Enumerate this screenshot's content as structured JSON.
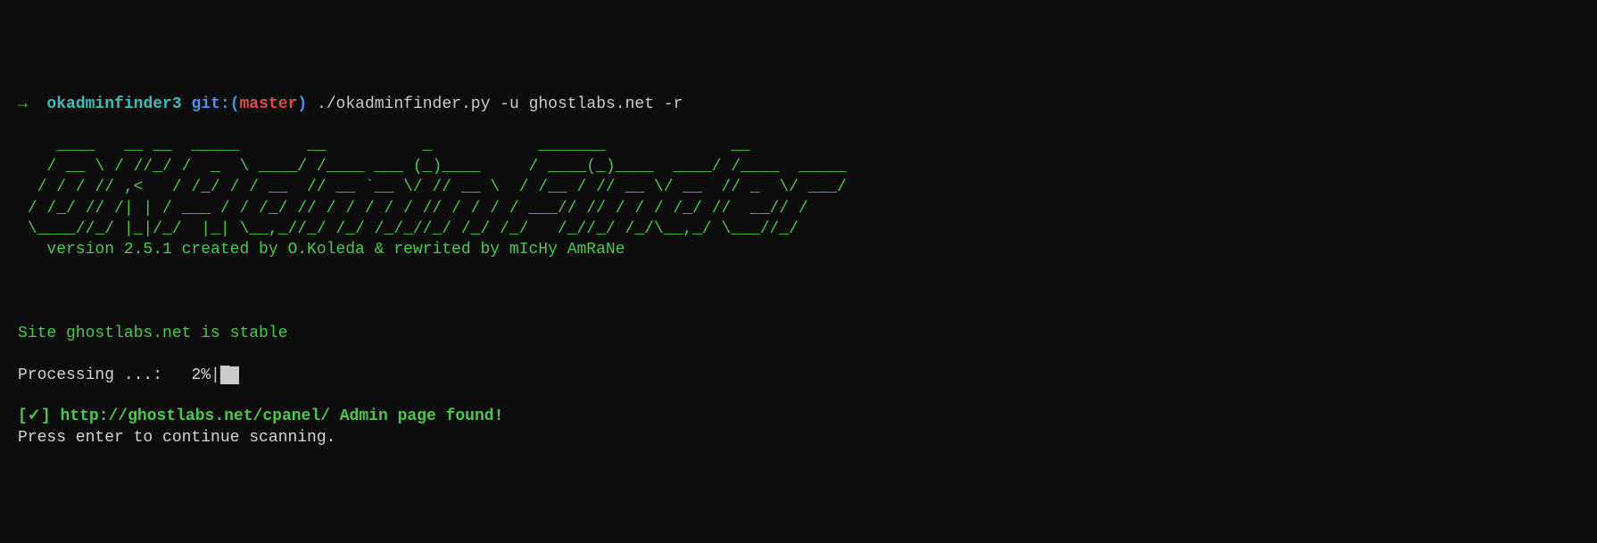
{
  "prompt": {
    "arrow": "→",
    "dir": "okadminfinder3",
    "git_label": "git:",
    "paren_open": "(",
    "branch": "master",
    "paren_close": ")",
    "command": "./okadminfinder.py -u ghostlabs.net -r"
  },
  "ascii_art": "    ____   __ __  _____       __          _           _______             __             \n   / __ \\ / //_/ /  _  \\ ____/ /____ ___ (_)____     / ____(_)____  ____/ /____  _____  \n  / / / // ,<   / /_/ / / __  // __ `__ \\/ // __ \\  / /__ / // __ \\/ __  // _  \\/ ___/  \n / /_/ // /| | / ___ / / /_/ // / / / / / // / / / / ___// // / / / /_/ //  __// /      \n \\____//_/ |_|/_/  |_| \\__,_//_/ /_/ /_/_//_/ /_/ /_/   /_//_/ /_/\\__,_/ \\___//_/       ",
  "version_line": "   version 2.5.1 created by O.Koleda & rewrited by mIcHy AmRaNe",
  "status_line": "Site ghostlabs.net is stable",
  "processing": {
    "label": "Processing ...:   ",
    "percent": "2%",
    "bar_sep": "|",
    "bar_fill": "█ "
  },
  "found": {
    "prefix": "[✓] ",
    "url": "http://ghostlabs.net/cpanel/",
    "suffix": " Admin page found!"
  },
  "continue_line": "Press enter to continue scanning."
}
